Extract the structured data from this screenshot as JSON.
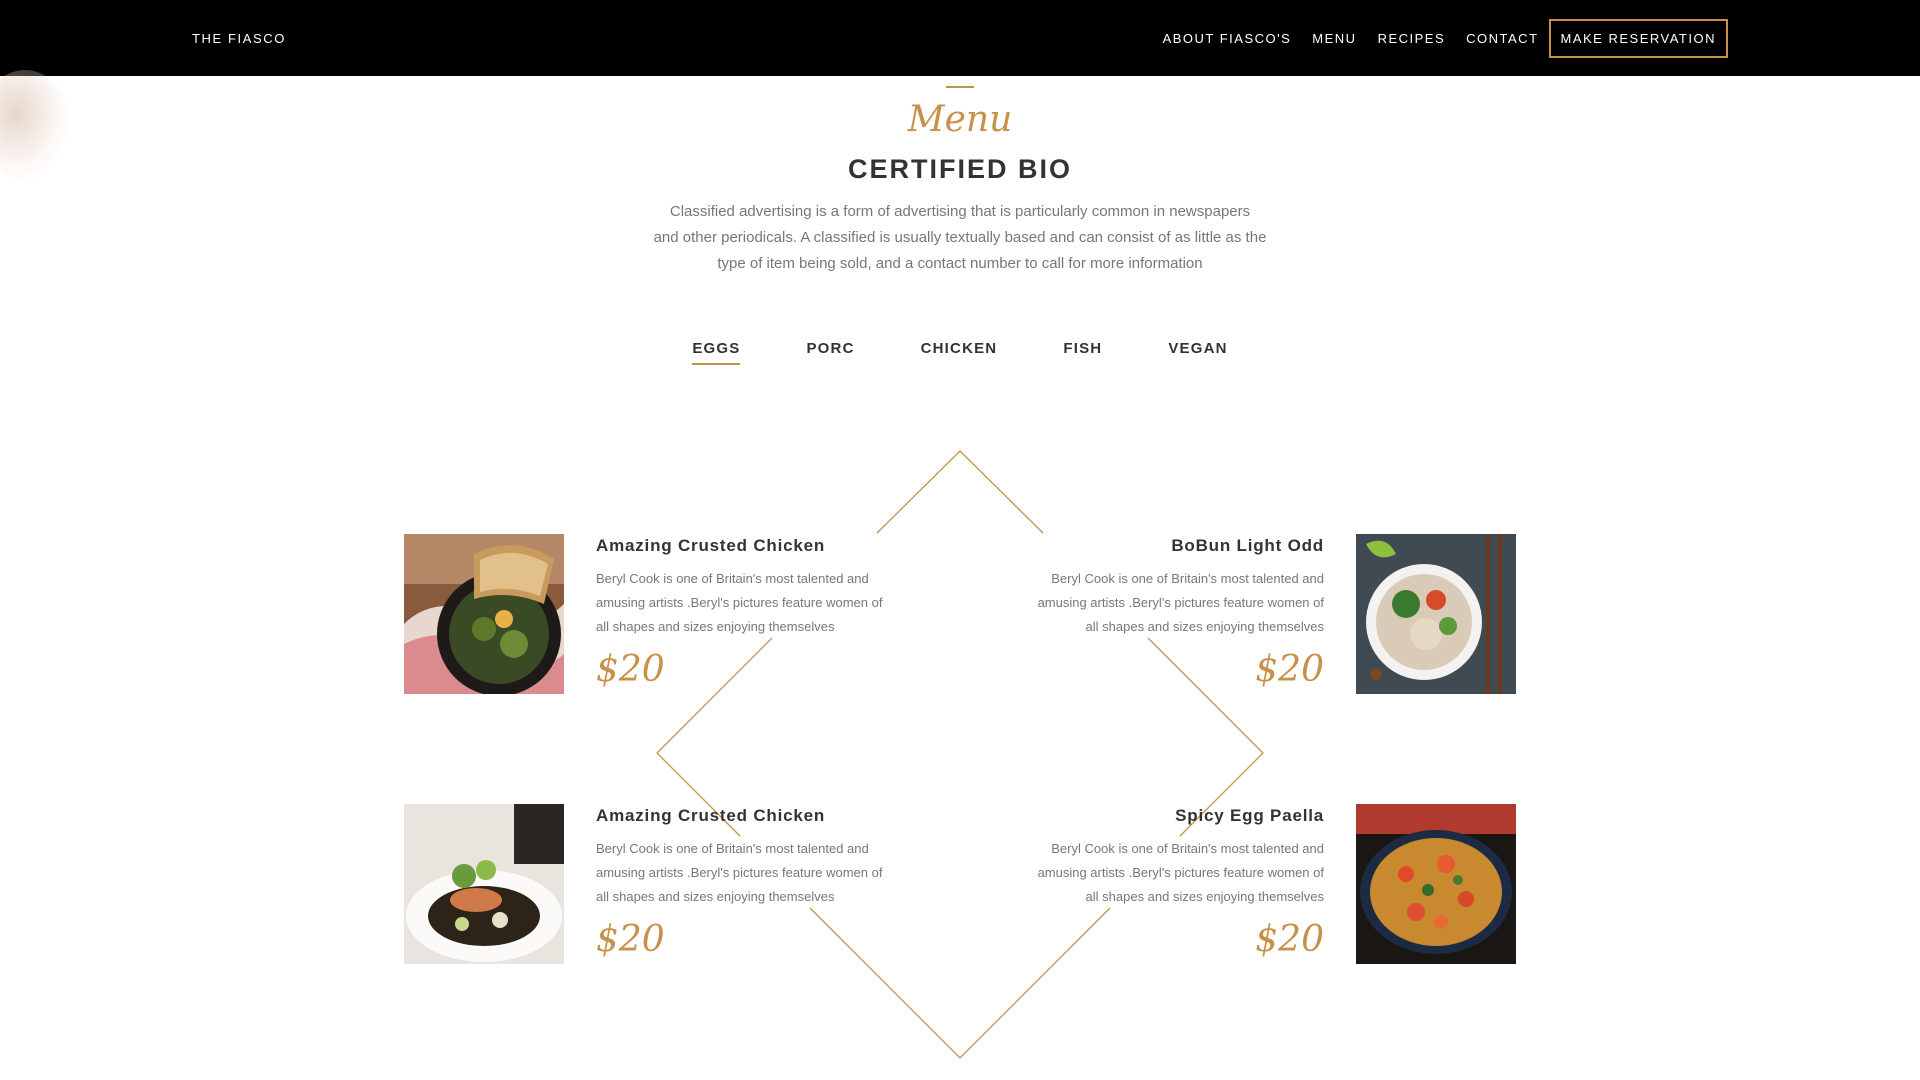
{
  "nav": {
    "brand": "THE FIASCO",
    "links": [
      "ABOUT FIASCO'S",
      "MENU",
      "RECIPES",
      "CONTACT"
    ],
    "cta": "MAKE RESERVATION"
  },
  "header": {
    "script_title": "Menu",
    "title": "CERTIFIED BIO",
    "intro_lines": [
      "Classified advertising is a form of advertising that is particularly common in newspapers",
      "and other periodicals. A classified is usually textually based and can consist of as little as the",
      "type of item being sold, and a contact number to call for more information"
    ]
  },
  "tabs": [
    "EGGS",
    "PORC",
    "CHICKEN",
    "FISH",
    "VEGAN"
  ],
  "items": [
    {
      "name": "Amazing Crusted Chicken",
      "desc_lines": [
        "Beryl Cook is one of Britain's most talented and",
        "amusing artists .Beryl's pictures feature women of",
        "all shapes and sizes enjoying themselves"
      ],
      "price": "$20"
    },
    {
      "name": "BoBun Light Odd",
      "desc_lines": [
        "Beryl Cook is one of Britain's most talented and",
        "amusing artists .Beryl's pictures feature women of",
        "all shapes and sizes enjoying themselves"
      ],
      "price": "$20"
    },
    {
      "name": "Amazing Crusted Chicken",
      "desc_lines": [
        "Beryl Cook is one of Britain's most talented and",
        "amusing artists .Beryl's pictures feature women of",
        "all shapes and sizes enjoying themselves"
      ],
      "price": "$20"
    },
    {
      "name": "Spicy Egg Paella",
      "desc_lines": [
        "Beryl Cook is one of Britain's most talented and",
        "amusing artists .Beryl's pictures feature women of",
        "all shapes and sizes enjoying themselves"
      ],
      "price": "$20"
    }
  ],
  "colors": {
    "accent": "#c8914a",
    "nav_bg": "#000000",
    "text": "#333333",
    "muted": "#777777"
  }
}
